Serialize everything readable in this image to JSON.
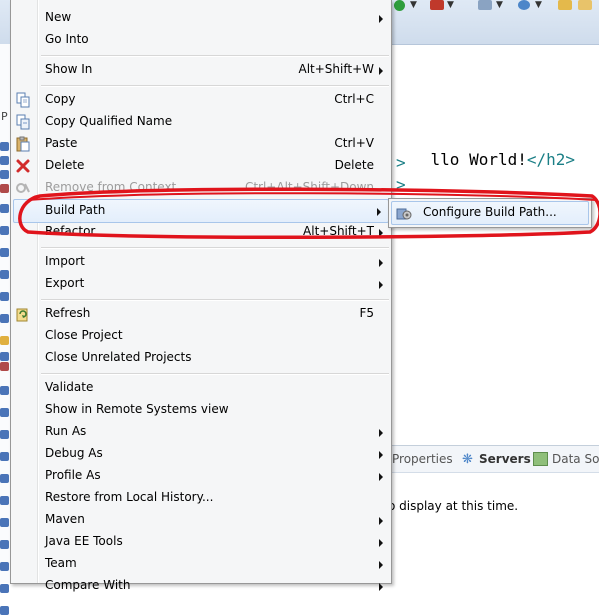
{
  "editor": {
    "code_line_1_text": "llo World!",
    "code_line_1_tag_close": "</h2>",
    "code_line_2_tag": ">",
    "code_line_3_tag": ">"
  },
  "left_panel": {
    "partial_label": "P"
  },
  "bottom_panel": {
    "tabs": [
      {
        "label": "Properties"
      },
      {
        "label": "Servers"
      },
      {
        "label": "Data So"
      }
    ],
    "status_message": "o display at this time."
  },
  "context_menu": {
    "items": [
      {
        "label": "New",
        "shortcut": "",
        "submenu": true
      },
      {
        "label": "Go Into",
        "shortcut": "",
        "submenu": false
      },
      {
        "label": "Show In",
        "shortcut": "Alt+Shift+W",
        "submenu": true
      },
      {
        "label": "Copy",
        "shortcut": "Ctrl+C",
        "submenu": false
      },
      {
        "label": "Copy Qualified Name",
        "shortcut": "",
        "submenu": false
      },
      {
        "label": "Paste",
        "shortcut": "Ctrl+V",
        "submenu": false
      },
      {
        "label": "Delete",
        "shortcut": "Delete",
        "submenu": false
      },
      {
        "label": "Remove from Context",
        "shortcut": "Ctrl+Alt+Shift+Down",
        "submenu": false,
        "disabled": true
      },
      {
        "label": "Build Path",
        "shortcut": "",
        "submenu": true,
        "highlighted": true
      },
      {
        "label": "Refactor",
        "shortcut": "Alt+Shift+T",
        "submenu": true
      },
      {
        "label": "Import",
        "shortcut": "",
        "submenu": true
      },
      {
        "label": "Export",
        "shortcut": "",
        "submenu": true
      },
      {
        "label": "Refresh",
        "shortcut": "F5",
        "submenu": false
      },
      {
        "label": "Close Project",
        "shortcut": "",
        "submenu": false
      },
      {
        "label": "Close Unrelated Projects",
        "shortcut": "",
        "submenu": false
      },
      {
        "label": "Validate",
        "shortcut": "",
        "submenu": false
      },
      {
        "label": "Show in Remote Systems view",
        "shortcut": "",
        "submenu": false
      },
      {
        "label": "Run As",
        "shortcut": "",
        "submenu": true
      },
      {
        "label": "Debug As",
        "shortcut": "",
        "submenu": true
      },
      {
        "label": "Profile As",
        "shortcut": "",
        "submenu": true
      },
      {
        "label": "Restore from Local History...",
        "shortcut": "",
        "submenu": false
      },
      {
        "label": "Maven",
        "shortcut": "",
        "submenu": true
      },
      {
        "label": "Java EE Tools",
        "shortcut": "",
        "submenu": true
      },
      {
        "label": "Team",
        "shortcut": "",
        "submenu": true
      },
      {
        "label": "Compare With",
        "shortcut": "",
        "submenu": true
      }
    ]
  },
  "submenu": {
    "item_label": "Configure Build Path..."
  },
  "colors": {
    "annotation_red": "#e0141c",
    "menu_highlight": "#e3eefb",
    "menu_highlight_border": "#a9c6ea",
    "code_tag": "#1b7f86"
  },
  "icons": {
    "copy": "copy-icon",
    "copy_qualified_name": "copy-qualified-name-icon",
    "paste": "paste-icon",
    "delete": "delete-icon",
    "remove_from_context": "remove-from-context-icon",
    "refresh": "refresh-icon",
    "configure_build_path": "configure-build-path-icon"
  }
}
